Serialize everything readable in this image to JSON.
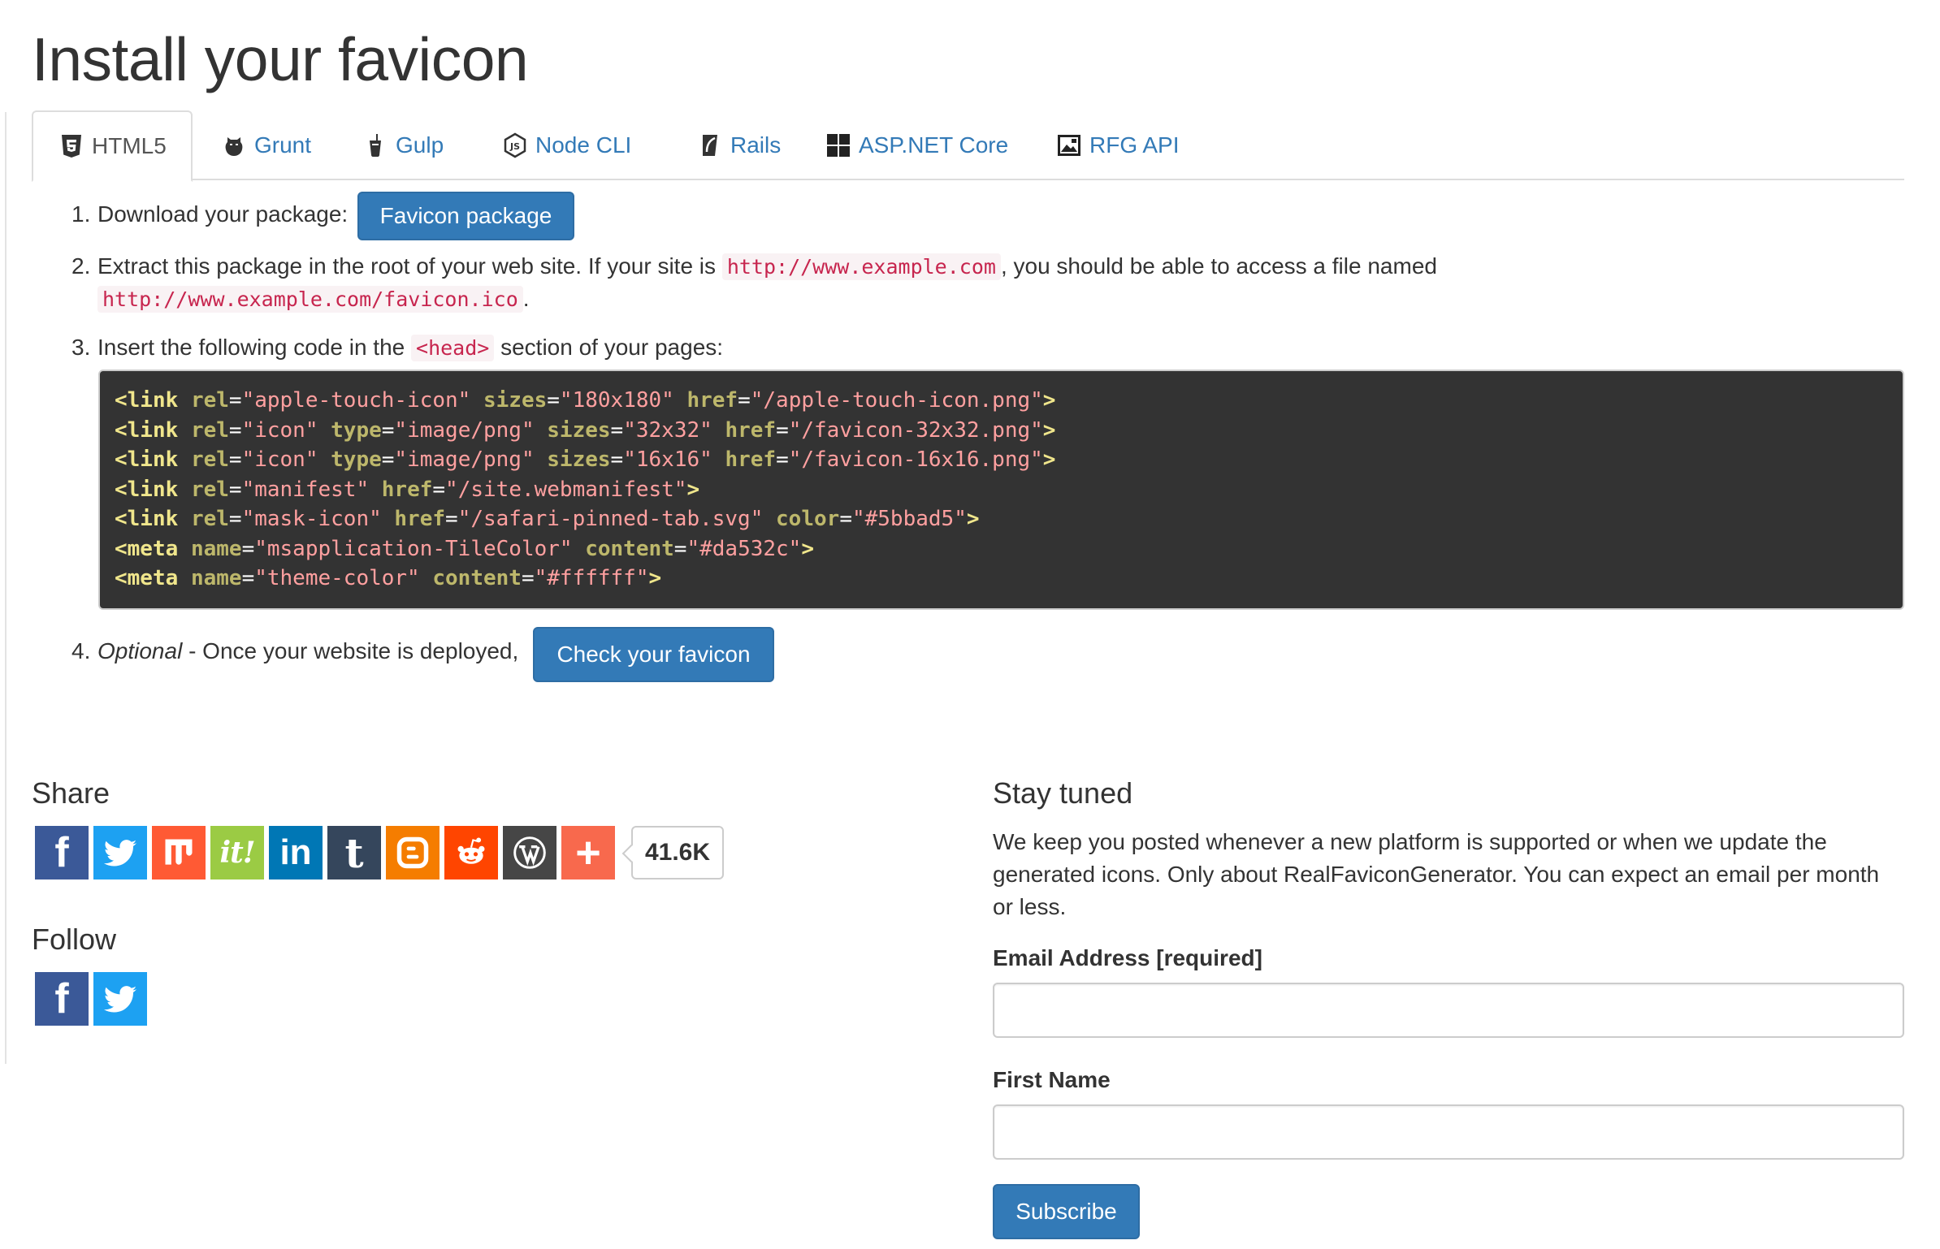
{
  "page": {
    "title": "Install your favicon"
  },
  "tabs": [
    {
      "label": "HTML5",
      "icon": "html5-icon",
      "active": true
    },
    {
      "label": "Grunt",
      "icon": "grunt-icon"
    },
    {
      "label": "Gulp",
      "icon": "gulp-icon"
    },
    {
      "label": "Node CLI",
      "icon": "nodejs-icon"
    },
    {
      "label": "Rails",
      "icon": "rails-icon"
    },
    {
      "label": "ASP.NET Core",
      "icon": "windows-icon"
    },
    {
      "label": "RFG API",
      "icon": "rfg-api-icon"
    }
  ],
  "steps": {
    "step1": {
      "num": "1.",
      "text": "Download your package:",
      "button": "Favicon package"
    },
    "step2": {
      "num": "2.",
      "text_a": "Extract this package in the root of your web site. If your site is",
      "code_a": "http://www.example.com",
      "text_b": ", you should be able to access a file named",
      "code_b": "http://www.example.com/favicon.ico",
      "text_c": "."
    },
    "step3": {
      "num": "3.",
      "text_a": "Insert the following code in the",
      "code": "<head>",
      "text_b": "section of your pages:"
    },
    "step4": {
      "num": "4.",
      "optional": "Optional",
      "text": " - Once your website is deployed,",
      "button": "Check your favicon"
    }
  },
  "code_lines": [
    [
      [
        "tg",
        "<link"
      ],
      [
        "pu",
        " "
      ],
      [
        "at",
        "rel"
      ],
      [
        "pu",
        "="
      ],
      [
        "st",
        "\"apple-touch-icon\""
      ],
      [
        "pu",
        " "
      ],
      [
        "at",
        "sizes"
      ],
      [
        "pu",
        "="
      ],
      [
        "st",
        "\"180x180\""
      ],
      [
        "pu",
        " "
      ],
      [
        "at",
        "href"
      ],
      [
        "pu",
        "="
      ],
      [
        "st",
        "\"/apple-touch-icon.png\""
      ],
      [
        "tg",
        ">"
      ]
    ],
    [
      [
        "tg",
        "<link"
      ],
      [
        "pu",
        " "
      ],
      [
        "at",
        "rel"
      ],
      [
        "pu",
        "="
      ],
      [
        "st",
        "\"icon\""
      ],
      [
        "pu",
        " "
      ],
      [
        "at",
        "type"
      ],
      [
        "pu",
        "="
      ],
      [
        "st",
        "\"image/png\""
      ],
      [
        "pu",
        " "
      ],
      [
        "at",
        "sizes"
      ],
      [
        "pu",
        "="
      ],
      [
        "st",
        "\"32x32\""
      ],
      [
        "pu",
        " "
      ],
      [
        "at",
        "href"
      ],
      [
        "pu",
        "="
      ],
      [
        "st",
        "\"/favicon-32x32.png\""
      ],
      [
        "tg",
        ">"
      ]
    ],
    [
      [
        "tg",
        "<link"
      ],
      [
        "pu",
        " "
      ],
      [
        "at",
        "rel"
      ],
      [
        "pu",
        "="
      ],
      [
        "st",
        "\"icon\""
      ],
      [
        "pu",
        " "
      ],
      [
        "at",
        "type"
      ],
      [
        "pu",
        "="
      ],
      [
        "st",
        "\"image/png\""
      ],
      [
        "pu",
        " "
      ],
      [
        "at",
        "sizes"
      ],
      [
        "pu",
        "="
      ],
      [
        "st",
        "\"16x16\""
      ],
      [
        "pu",
        " "
      ],
      [
        "at",
        "href"
      ],
      [
        "pu",
        "="
      ],
      [
        "st",
        "\"/favicon-16x16.png\""
      ],
      [
        "tg",
        ">"
      ]
    ],
    [
      [
        "tg",
        "<link"
      ],
      [
        "pu",
        " "
      ],
      [
        "at",
        "rel"
      ],
      [
        "pu",
        "="
      ],
      [
        "st",
        "\"manifest\""
      ],
      [
        "pu",
        " "
      ],
      [
        "at",
        "href"
      ],
      [
        "pu",
        "="
      ],
      [
        "st",
        "\"/site.webmanifest\""
      ],
      [
        "tg",
        ">"
      ]
    ],
    [
      [
        "tg",
        "<link"
      ],
      [
        "pu",
        " "
      ],
      [
        "at",
        "rel"
      ],
      [
        "pu",
        "="
      ],
      [
        "st",
        "\"mask-icon\""
      ],
      [
        "pu",
        " "
      ],
      [
        "at",
        "href"
      ],
      [
        "pu",
        "="
      ],
      [
        "st",
        "\"/safari-pinned-tab.svg\""
      ],
      [
        "pu",
        " "
      ],
      [
        "at",
        "color"
      ],
      [
        "pu",
        "="
      ],
      [
        "st",
        "\"#5bbad5\""
      ],
      [
        "tg",
        ">"
      ]
    ],
    [
      [
        "tg",
        "<meta"
      ],
      [
        "pu",
        " "
      ],
      [
        "at",
        "name"
      ],
      [
        "pu",
        "="
      ],
      [
        "st",
        "\"msapplication-TileColor\""
      ],
      [
        "pu",
        " "
      ],
      [
        "at",
        "content"
      ],
      [
        "pu",
        "="
      ],
      [
        "st",
        "\"#da532c\""
      ],
      [
        "tg",
        ">"
      ]
    ],
    [
      [
        "tg",
        "<meta"
      ],
      [
        "pu",
        " "
      ],
      [
        "at",
        "name"
      ],
      [
        "pu",
        "="
      ],
      [
        "st",
        "\"theme-color\""
      ],
      [
        "pu",
        " "
      ],
      [
        "at",
        "content"
      ],
      [
        "pu",
        "="
      ],
      [
        "st",
        "\"#ffffff\""
      ],
      [
        "tg",
        ">"
      ]
    ]
  ],
  "share": {
    "title": "Share",
    "buttons": [
      {
        "name": "facebook",
        "icon": "facebook-icon",
        "color": "#3b5998",
        "glyph": "f"
      },
      {
        "name": "twitter",
        "icon": "twitter-icon",
        "color": "#1da1f2"
      },
      {
        "name": "mix",
        "icon": "mix-icon",
        "color": "#ff5a34"
      },
      {
        "name": "scoopit",
        "icon": "scoopit-icon",
        "color": "#9bcb44",
        "glyph": "it!"
      },
      {
        "name": "linkedin",
        "icon": "linkedin-icon",
        "color": "#0077b5",
        "glyph": "in"
      },
      {
        "name": "tumblr",
        "icon": "tumblr-icon",
        "color": "#35465c",
        "glyph": "t"
      },
      {
        "name": "blogger",
        "icon": "blogger-icon",
        "color": "#f57d00"
      },
      {
        "name": "reddit",
        "icon": "reddit-icon",
        "color": "#ff4500"
      },
      {
        "name": "wordpress",
        "icon": "wordpress-icon",
        "color": "#464646"
      },
      {
        "name": "more",
        "icon": "plus-icon",
        "color": "#f8694d",
        "glyph": "+"
      }
    ],
    "count": "41.6K"
  },
  "follow": {
    "title": "Follow",
    "buttons": [
      {
        "name": "facebook",
        "icon": "facebook-icon",
        "color": "#3b5998",
        "glyph": "f"
      },
      {
        "name": "twitter",
        "icon": "twitter-icon",
        "color": "#1da1f2"
      }
    ]
  },
  "stay_tuned": {
    "title": "Stay tuned",
    "description": "We keep you posted whenever a new platform is supported or when we update the generated icons. Only about RealFaviconGenerator. You can expect an email per month or less.",
    "email_label": "Email Address [required]",
    "email_value": "",
    "first_name_label": "First Name",
    "first_name_value": "",
    "subscribe_label": "Subscribe"
  }
}
